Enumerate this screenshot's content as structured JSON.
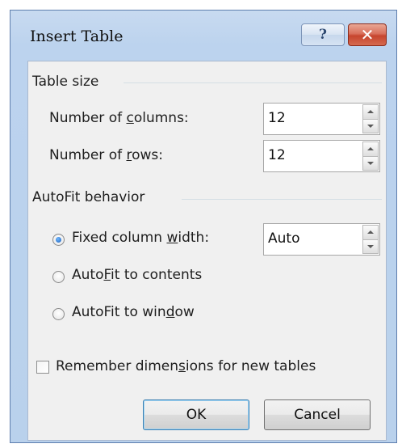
{
  "window": {
    "title": "Insert Table",
    "help_glyph": "?",
    "close_glyph": "✕"
  },
  "table_size": {
    "group_label": "Table size",
    "columns": {
      "label_pre": "Number of ",
      "label_mn": "c",
      "label_post": "olumns:",
      "value": "12"
    },
    "rows": {
      "label_pre": "Number of ",
      "label_mn": "r",
      "label_post": "ows:",
      "value": "12"
    }
  },
  "autofit": {
    "group_label": "AutoFit behavior",
    "fixed": {
      "pre": "Fixed column ",
      "mn": "w",
      "post": "idth:",
      "selected": true,
      "value": "Auto"
    },
    "contents": {
      "pre": "Auto",
      "mn": "F",
      "post": "it to contents",
      "selected": false
    },
    "window": {
      "pre": "AutoFit to win",
      "mn": "d",
      "post": "ow",
      "selected": false
    }
  },
  "remember": {
    "pre": "Remember dimen",
    "mn": "s",
    "post": "ions for new tables",
    "checked": false
  },
  "buttons": {
    "ok": "OK",
    "cancel": "Cancel"
  },
  "icons": {
    "help": "question-mark-icon",
    "close": "close-x-icon",
    "spin_up": "spin-up-arrow-icon",
    "spin_down": "spin-down-arrow-icon"
  },
  "colors": {
    "frame": "#b9d1ec",
    "close_button": "#c6452e",
    "default_button_border": "#3c7fb1"
  }
}
